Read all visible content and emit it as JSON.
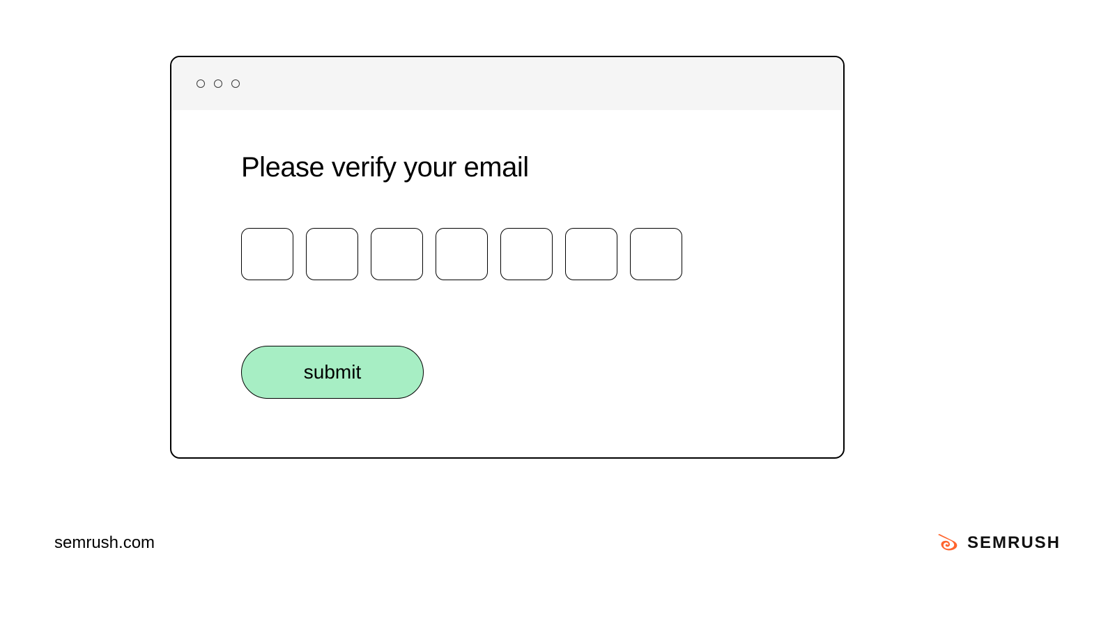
{
  "form": {
    "heading": "Please verify your email",
    "submit_label": "submit",
    "code_digits": [
      "",
      "",
      "",
      "",
      "",
      "",
      ""
    ]
  },
  "footer": {
    "url": "semrush.com",
    "brand": "SEMRUSH"
  }
}
